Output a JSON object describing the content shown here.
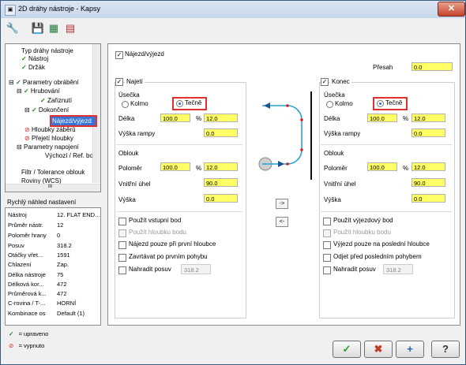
{
  "window": {
    "title": "2D dráhy nástroje - Kapsy",
    "close": "✕"
  },
  "toolbar": {
    "tool_icon": "tool-icon",
    "save_icon": "save-icon",
    "save_all_icon": "save-all-icon",
    "library_icon": "library-icon"
  },
  "tree": {
    "items": [
      "Typ dráhy nástroje",
      "Nástroj",
      "Držák",
      "Parametry obrábění",
      "Hrubování",
      "Zařiznutí",
      "Dokončení",
      "Nájezd/výjezd",
      "Hloubky záběrů",
      "Přejetí hloubky",
      "Parametry napojení",
      "Výchozí / Ref. bod",
      "Filtr / Tolerance oblouk",
      "Roviny (WCS)"
    ],
    "scroll_mark": "III"
  },
  "quick": {
    "title": "Rychlý náhled nastavení",
    "rows": [
      {
        "k": "Nástroj",
        "v": "12. FLAT END..."
      },
      {
        "k": "Průměr nástr.",
        "v": "12"
      },
      {
        "k": "Poloměr hrany",
        "v": "0"
      },
      {
        "k": "Posuv",
        "v": "318.2"
      },
      {
        "k": "Otáčky vřet...",
        "v": "1591"
      },
      {
        "k": "Chlazení",
        "v": "Zap."
      },
      {
        "k": "Délka nástroje",
        "v": "75"
      },
      {
        "k": "Délková kor...",
        "v": "472"
      },
      {
        "k": "Průměrová k...",
        "v": "472"
      },
      {
        "k": "C-rovina / T-...",
        "v": "HORNÍ"
      },
      {
        "k": "Kombinace os",
        "v": "Default (1)"
      }
    ]
  },
  "legend": {
    "edited": "= upraveno",
    "disabled": "= vypnuto",
    "edited_glyph": "✓",
    "disabled_glyph": "⊘"
  },
  "main": {
    "entry_exit": "Nájezd/výjezd",
    "overlap_label": "Přesah",
    "overlap_value": "0.0",
    "entry": {
      "title": "Najetí",
      "line_title": "Úsečka",
      "perp": "Kolmo",
      "tangent": "Tečně",
      "length_label": "Délka",
      "length_value": "100.0",
      "pct": "%",
      "length_abs": "12.0",
      "ramp_label": "Výška rampy",
      "ramp_value": "0.0",
      "arc_title": "Oblouk",
      "radius_label": "Poloměr",
      "radius_value": "100.0",
      "radius_abs": "12.0",
      "sweep_label": "Vnitřní úhel",
      "sweep_value": "90.0",
      "height_label": "Výška",
      "height_value": "0.0",
      "opt_use_point": "Použít vstupní bod",
      "opt_use_depth": "Použít hloubku bodu",
      "opt_first_depth": "Nájezd pouze při první hloubce",
      "opt_ramp_first": "Zavrtávat po prvním pohybu",
      "opt_override_feed": "Nahradit posuv",
      "feed_value": "318.2"
    },
    "exit": {
      "title": "Konec",
      "line_title": "Úsečka",
      "perp": "Kolmo",
      "tangent": "Tečně",
      "length_label": "Délka",
      "length_value": "100.0",
      "pct": "%",
      "length_abs": "12.0",
      "ramp_label": "Výška rampy",
      "ramp_value": "0.0",
      "arc_title": "Oblouk",
      "radius_label": "Poloměr",
      "radius_value": "100.0",
      "radius_abs": "12.0",
      "sweep_label": "Vnitřní úhel",
      "sweep_value": "90.0",
      "height_label": "Výška",
      "height_value": "0.0",
      "opt_use_point": "Použít výjezdový bod",
      "opt_use_depth": "Použít hloubku bodu",
      "opt_last_depth": "Výjezd pouze na poslední hloubce",
      "opt_retract_last": "Odjet před posledním pohybem",
      "opt_override_feed": "Nahradit posuv",
      "feed_value": "318.2"
    },
    "copy_right": "->",
    "copy_left": "<-"
  },
  "buttons": {
    "ok": "✓",
    "cancel": "✖",
    "apply": "+",
    "help": "?"
  },
  "colors": {
    "accent": "#3875d7",
    "highlight": "#e03030",
    "field_yellow": "#ffff66"
  }
}
